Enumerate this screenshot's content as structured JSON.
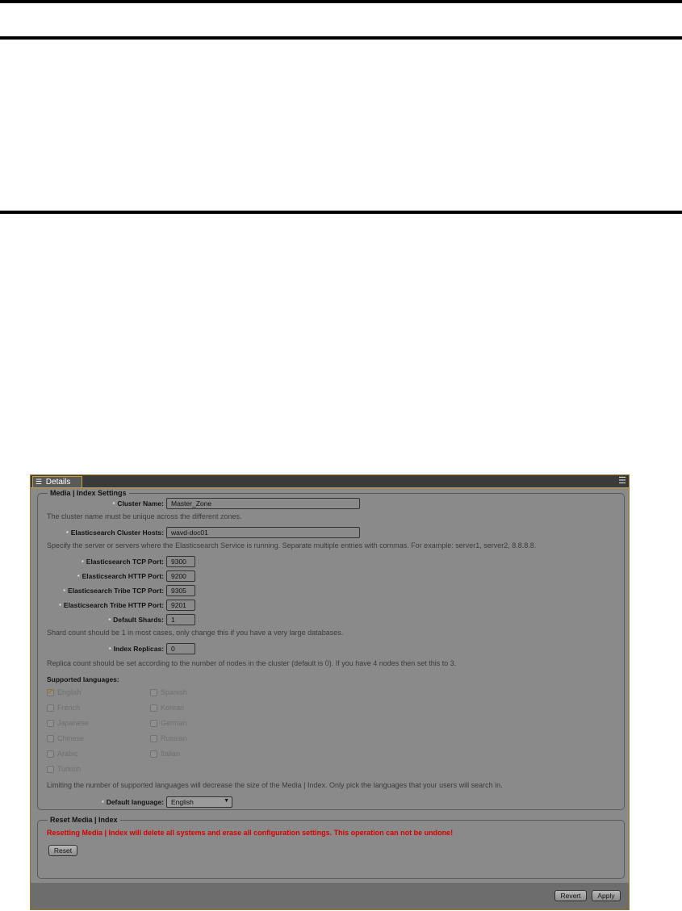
{
  "panel": {
    "tab_label": "Details",
    "tab_icon": "list-icon",
    "menu_icon": "hamburger-icon"
  },
  "index_settings": {
    "legend": "Media | Index Settings",
    "required_marker": "*",
    "cluster_name": {
      "label": "Cluster Name:",
      "value": "Master_Zone",
      "help": "The cluster name must be unique across the different zones."
    },
    "cluster_hosts": {
      "label": "Elasticsearch Cluster Hosts:",
      "value": "wavd-doc01",
      "help": "Specify the server or servers where the Elasticsearch Service is running. Separate multiple entries with commas. For example: server1, server2, 8.8.8.8."
    },
    "tcp_port": {
      "label": "Elasticsearch TCP Port:",
      "value": "9300"
    },
    "http_port": {
      "label": "Elasticsearch HTTP Port:",
      "value": "9200"
    },
    "tribe_tcp_port": {
      "label": "Elasticsearch Tribe TCP Port:",
      "value": "9305"
    },
    "tribe_http_port": {
      "label": "Elasticsearch Tribe HTTP Port:",
      "value": "9201"
    },
    "default_shards": {
      "label": "Default Shards:",
      "value": "1",
      "help": "Shard count should be 1 in most cases, only change this if you have a very large databases."
    },
    "index_replicas": {
      "label": "Index Replicas:",
      "value": "0",
      "help": "Replica count should be set according to the number of nodes in the cluster (default is 0). If you have 4 nodes then set this to 3."
    },
    "languages": {
      "heading": "Supported languages:",
      "items": [
        {
          "label": "English",
          "checked": true
        },
        {
          "label": "Spanish",
          "checked": false
        },
        {
          "label": "French",
          "checked": false
        },
        {
          "label": "Korean",
          "checked": false
        },
        {
          "label": "Japanese",
          "checked": false
        },
        {
          "label": "German",
          "checked": false
        },
        {
          "label": "Chinese",
          "checked": false
        },
        {
          "label": "Russian",
          "checked": false
        },
        {
          "label": "Arabic",
          "checked": false
        },
        {
          "label": "Italian",
          "checked": false
        },
        {
          "label": "Turkish",
          "checked": false
        }
      ],
      "help": "Limiting the number of supported languages will decrease the size of the Media | Index. Only pick the languages that your users will search in."
    },
    "default_language": {
      "label": "Default language:",
      "value": "English"
    }
  },
  "reset": {
    "legend": "Reset Media | Index",
    "warning": "Resetting Media | Index will delete all systems and erase all configuration settings. This operation can not be undone!",
    "button": "Reset"
  },
  "footer": {
    "revert": "Revert",
    "apply": "Apply"
  }
}
